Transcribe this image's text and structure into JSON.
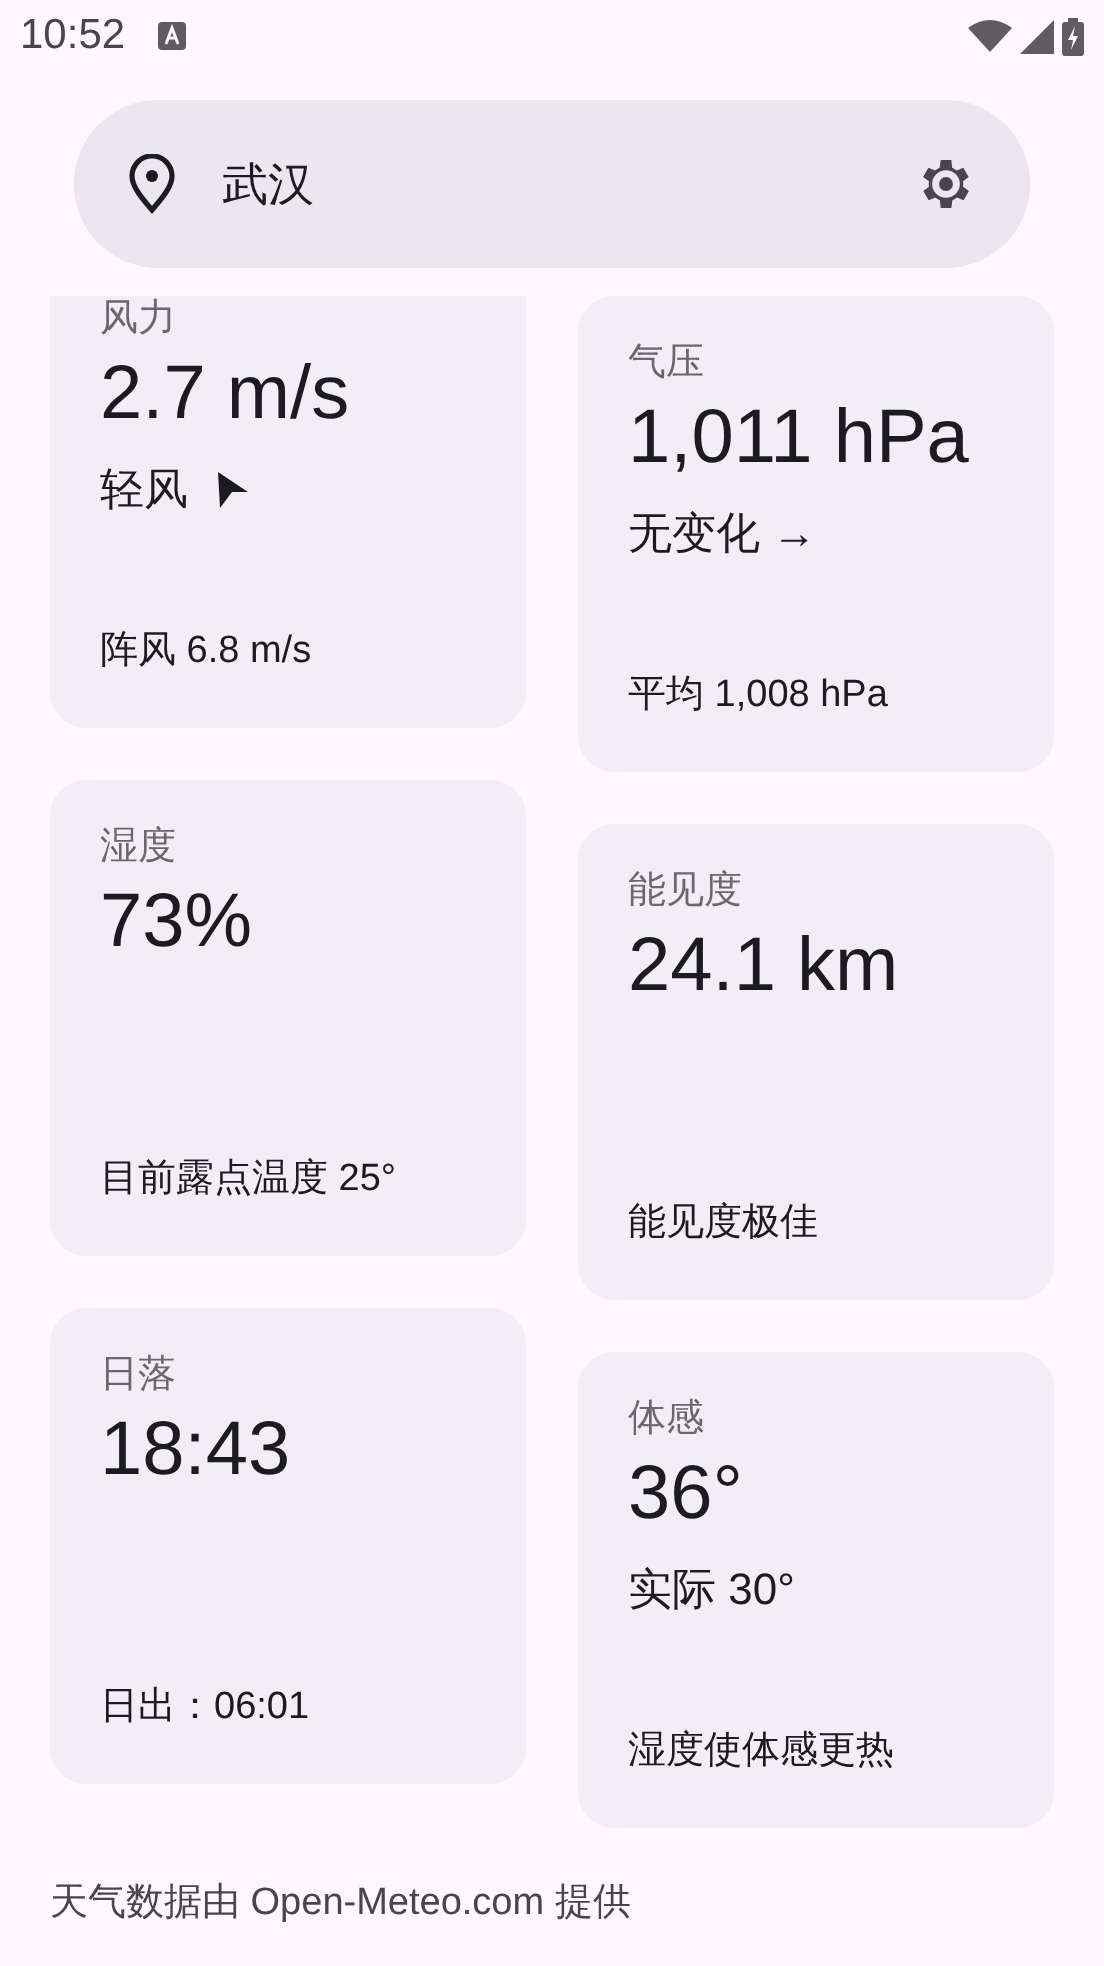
{
  "status_bar": {
    "time": "10:52"
  },
  "search_bar": {
    "location": "武汉"
  },
  "cards": [
    {
      "kind": "wind",
      "title": "风力",
      "value": "2.7 m/s",
      "detail": "轻风",
      "footer": "阵风 6.8 m/s"
    },
    {
      "kind": "plain",
      "title": "气压",
      "value": "1,011 hPa",
      "detail": "无变化 →",
      "footer": "平均 1,008 hPa"
    },
    {
      "kind": "plain",
      "title": "湿度",
      "value": "73%",
      "footer": "目前露点温度 25°"
    },
    {
      "kind": "plain",
      "title": "能见度",
      "value": "24.1 km",
      "footer": "能见度极佳"
    },
    {
      "kind": "plain",
      "title": "日落",
      "value": "18:43",
      "footer": "日出：06:01"
    },
    {
      "kind": "plain",
      "title": "体感",
      "value": "36°",
      "detail": "实际 30°",
      "footer": "湿度使体感更热"
    }
  ],
  "attribution": "天气数据由 Open-Meteo.com 提供"
}
